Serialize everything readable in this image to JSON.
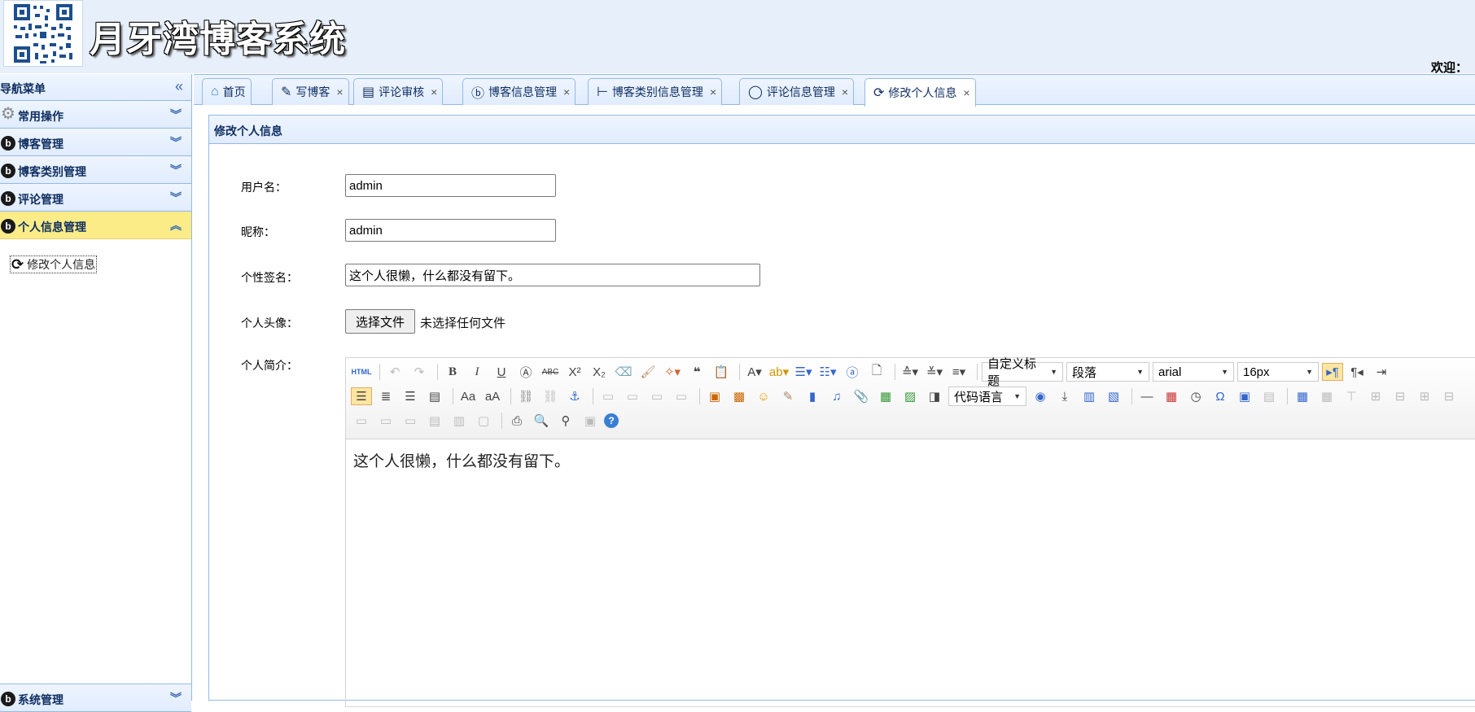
{
  "header": {
    "title": "月牙湾博客系统",
    "welcome": "欢迎："
  },
  "sidebar": {
    "title": "导航菜单",
    "sections": [
      {
        "label": "常用操作",
        "icon": "gear-icon"
      },
      {
        "label": "博客管理",
        "icon": "blog-icon"
      },
      {
        "label": "博客类别管理",
        "icon": "blog-icon"
      },
      {
        "label": "评论管理",
        "icon": "blog-icon"
      },
      {
        "label": "个人信息管理",
        "icon": "blog-icon"
      }
    ],
    "active_submenu": {
      "label": "修改个人信息",
      "icon": "refresh-icon"
    },
    "bottom_section": {
      "label": "系统管理",
      "icon": "blog-icon"
    }
  },
  "tabs": [
    {
      "label": "首页",
      "icon": "home-icon",
      "closable": false
    },
    {
      "label": "写博客",
      "icon": "edit-icon",
      "closable": true
    },
    {
      "label": "评论审核",
      "icon": "review-icon",
      "closable": true
    },
    {
      "label": "博客信息管理",
      "icon": "blog-icon",
      "closable": true
    },
    {
      "label": "博客类别信息管理",
      "icon": "tree-icon",
      "closable": true
    },
    {
      "label": "评论信息管理",
      "icon": "comment-icon",
      "closable": true
    },
    {
      "label": "修改个人信息",
      "icon": "refresh-icon",
      "closable": true,
      "active": true
    }
  ],
  "tab_close_glyph": "×",
  "panel": {
    "title": "修改个人信息",
    "form": {
      "username_label": "用户名：",
      "username_value": "admin",
      "nickname_label": "昵称：",
      "nickname_value": "admin",
      "sign_label": "个性签名：",
      "sign_value": "这个人很懒，什么都没有留下。",
      "avatar_label": "个人头像：",
      "file_button": "选择文件",
      "file_status": "未选择任何文件",
      "profile_label": "个人简介："
    },
    "editor": {
      "selects": {
        "custom_title": "自定义标题",
        "paragraph": "段落",
        "font_family": "arial",
        "font_size": "16px",
        "code_lang": "代码语言"
      },
      "content": "这个人很懒，什么都没有留下。"
    }
  },
  "colors": {
    "header_bg": "#e6effa",
    "panel_border": "#95b8e7",
    "active_section_bg": "#fbec88",
    "label_color": "#0e2d5f"
  }
}
